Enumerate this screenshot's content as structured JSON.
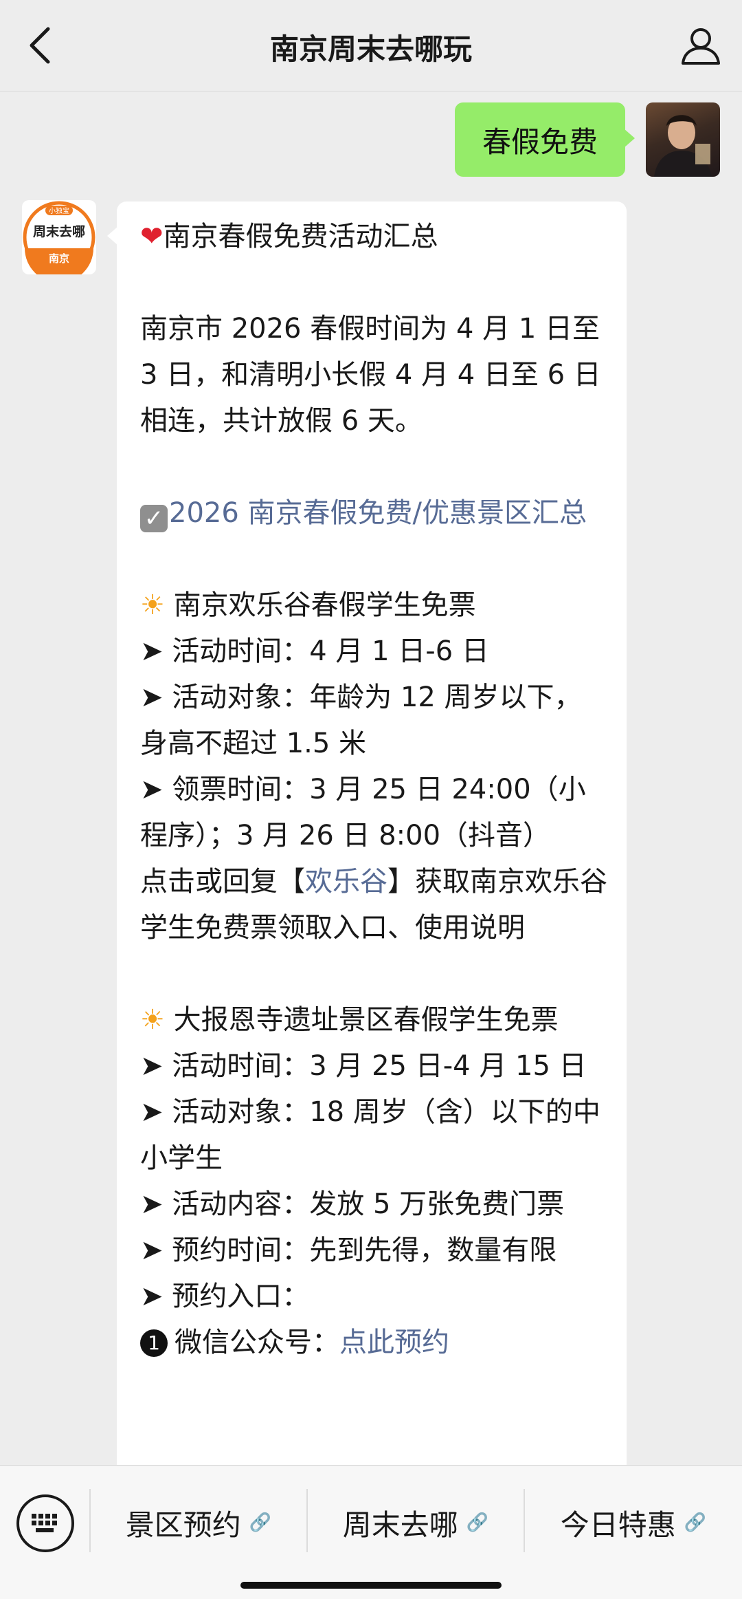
{
  "header": {
    "title": "南京周末去哪玩",
    "back_icon": "chevron-left-icon",
    "profile_icon": "person-icon"
  },
  "chat": {
    "user_message": "春假免费",
    "bot_avatar": {
      "tag": "小独宝",
      "brand": "周末去哪",
      "city": "南京",
      "brand_color": "#f07a1e"
    },
    "bot_message": {
      "heading": "南京春假免费活动汇总",
      "intro": "南京市 2026 春假时间为 4 月 1 日至 3 日，和清明小长假 4 月 4 日至 6 日相连，共计放假 6 天。",
      "summary_link": "2026 南京春假免费/优惠景区汇总",
      "section1": {
        "title": "南京欢乐谷春假学生免票",
        "line1": "➤ 活动时间：4 月 1 日-6 日",
        "line2": "➤ 活动对象：年龄为 12 周岁以下，身高不超过 1.5 米",
        "line3": "➤ 领票时间：3 月 25 日 24:00（小程序）；3 月 26 日 8:00（抖音）",
        "reply_prefix": "点击或回复【",
        "reply_keyword": "欢乐谷",
        "reply_suffix": "】获取南京欢乐谷学生免费票领取入口、使用说明"
      },
      "section2": {
        "title": "大报恩寺遗址景区春假学生免票",
        "line1": "➤ 活动时间：3 月 25 日-4 月 15 日",
        "line2": "➤ 活动对象：18 周岁（含）以下的中小学生",
        "line3": "➤ 活动内容：发放 5 万张免费门票",
        "line4": "➤ 预约时间：先到先得，数量有限",
        "line5": "➤ 预约入口：",
        "entry1_num": "1",
        "entry1_label": "微信公众号：",
        "entry1_link": "点此预约"
      }
    }
  },
  "bottom_menu": {
    "keyboard_icon": "keyboard-icon",
    "items": [
      {
        "label": "景区预约",
        "icon": "link-icon"
      },
      {
        "label": "周末去哪",
        "icon": "link-icon"
      },
      {
        "label": "今日特惠",
        "icon": "link-icon"
      }
    ]
  }
}
